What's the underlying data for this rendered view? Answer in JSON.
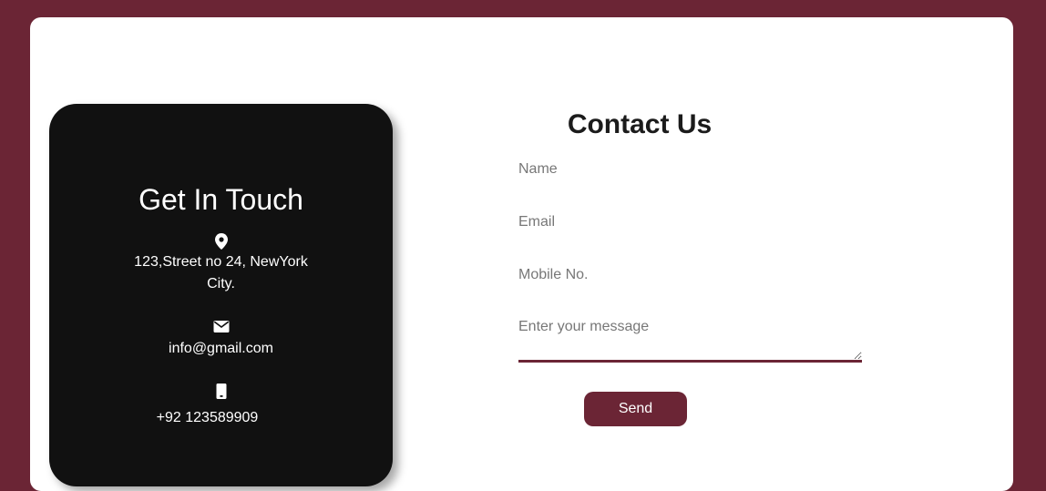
{
  "colors": {
    "background": "#6b2535",
    "card": "#ffffff",
    "info_card": "#111111",
    "accent": "#6b2535"
  },
  "info": {
    "title": "Get In Touch",
    "address_icon": "map-pin-icon",
    "address_line1": "123,Street no 24, NewYork",
    "address_line2": "City.",
    "email_icon": "envelope-icon",
    "email": "info@gmail.com",
    "phone_icon": "mobile-phone-icon",
    "phone": "+92 123589909"
  },
  "form": {
    "title": "Contact Us",
    "name_placeholder": "Name",
    "email_placeholder": "Email",
    "mobile_placeholder": "Mobile No.",
    "message_placeholder": "Enter your message",
    "send_label": "Send"
  }
}
